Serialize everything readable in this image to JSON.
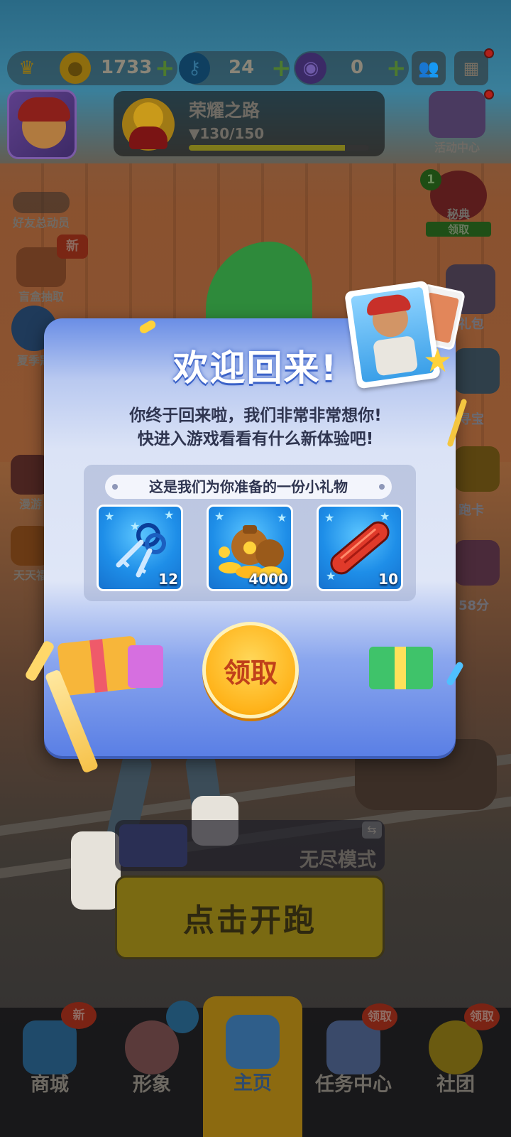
{
  "top_bar": {
    "coins": "1733",
    "keys": "24",
    "tokens": "0",
    "plus": "+"
  },
  "glory": {
    "title": "荣耀之路",
    "progress_text": "130/150",
    "progress_fraction": 0.867
  },
  "left_menu": [
    {
      "label": "好友总动员",
      "icon": "friends-icon"
    },
    {
      "label": "盲盒抽取",
      "icon": "blind-box-icon",
      "badge": "新"
    },
    {
      "label": "夏季冠",
      "icon": "summer-icon"
    },
    {
      "label": "漫游",
      "icon": "roam-icon"
    },
    {
      "label": "天天福",
      "icon": "daily-icon"
    }
  ],
  "right_menu": [
    {
      "label": "活动中心",
      "icon": "calendar-icon"
    },
    {
      "label": "秘典",
      "sub": "领取",
      "badge": "1",
      "icon": "flower-icon"
    },
    {
      "label": "礼包",
      "icon": "gift-pack-icon"
    },
    {
      "label": "寻宝",
      "icon": "treasure-icon"
    },
    {
      "label": "跑卡",
      "icon": "run-card-icon"
    },
    {
      "label": "58分",
      "icon": "timer-icon"
    }
  ],
  "dialog": {
    "title": "欢迎回来!",
    "line1": "你终于回来啦，我们非常非常想你!",
    "line2": "快进入游戏看看有什么新体验吧!",
    "gift_label": "这是我们为你准备的一份小礼物",
    "items": [
      {
        "icon": "keys-icon",
        "count": "12"
      },
      {
        "icon": "coin-bag-icon",
        "count": "4000"
      },
      {
        "icon": "hoverboard-icon",
        "count": "10"
      }
    ],
    "claim_label": "领取"
  },
  "start": {
    "mode_label": "无尽模式",
    "start_label": "点击开跑"
  },
  "nav": [
    {
      "label": "商城",
      "tag": "新",
      "icon": "shop-icon"
    },
    {
      "label": "形象",
      "icon": "character-icon"
    },
    {
      "label": "主页",
      "icon": "home-icon",
      "active": true
    },
    {
      "label": "任务中心",
      "tag": "领取",
      "icon": "task-icon"
    },
    {
      "label": "社团",
      "tag": "领取",
      "icon": "club-icon"
    }
  ],
  "colors": {
    "dialog_blue": "#6a8ee6",
    "claim_gold": "#ffb31a",
    "item_blue": "#1e8ee8"
  }
}
